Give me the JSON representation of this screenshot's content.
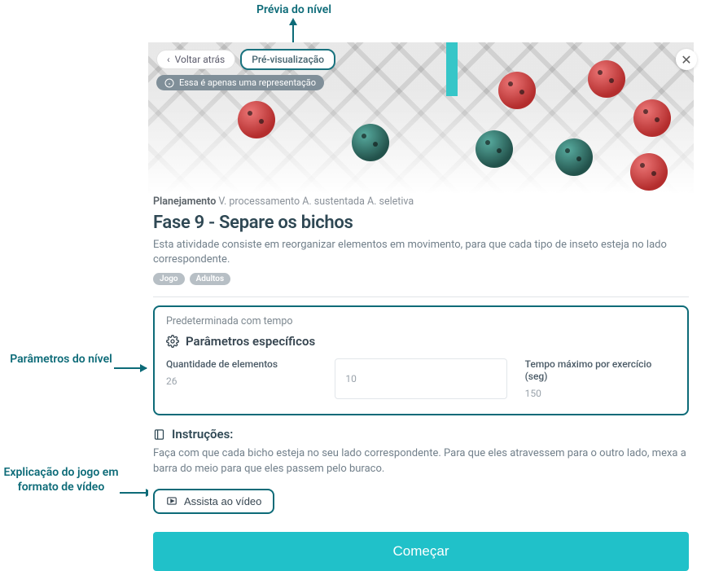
{
  "annotations": {
    "preview": "Prévia do nível",
    "params": "Parâmetros do nível",
    "video": "Explicação do jogo em formato de vídeo"
  },
  "topbar": {
    "back_label": "Voltar atrás",
    "preview_label": "Pré-visualização",
    "rep_note": "Essa é apenas uma representação"
  },
  "breadcrumb": {
    "strong": "Planejamento",
    "rest": " V. processamento A. sustentada A. seletiva"
  },
  "title": "Fase 9 - Separe os bichos",
  "description": "Esta atividade consiste em reorganizar elementos em movimento, para que cada tipo de inseto esteja no lado correspondente.",
  "tags": [
    "Jogo",
    "Adultos"
  ],
  "params": {
    "top_note": "Predeterminada com tempo",
    "heading": "Parâmetros específicos",
    "cells": {
      "qty_label": "Quantidade de elementos",
      "qty_value": "26",
      "mid_value": "10",
      "time_label": "Tempo máximo por exercício (seg)",
      "time_value": "150"
    }
  },
  "instructions": {
    "heading": "Instruções:",
    "text": "Faça com que cada bicho esteja no seu lado correspondente. Para que eles atravessem para o outro lado, mexa a barra do meio para que eles passem pelo buraco."
  },
  "video_button": "Assista ao vídeo",
  "start_button": "Começar"
}
